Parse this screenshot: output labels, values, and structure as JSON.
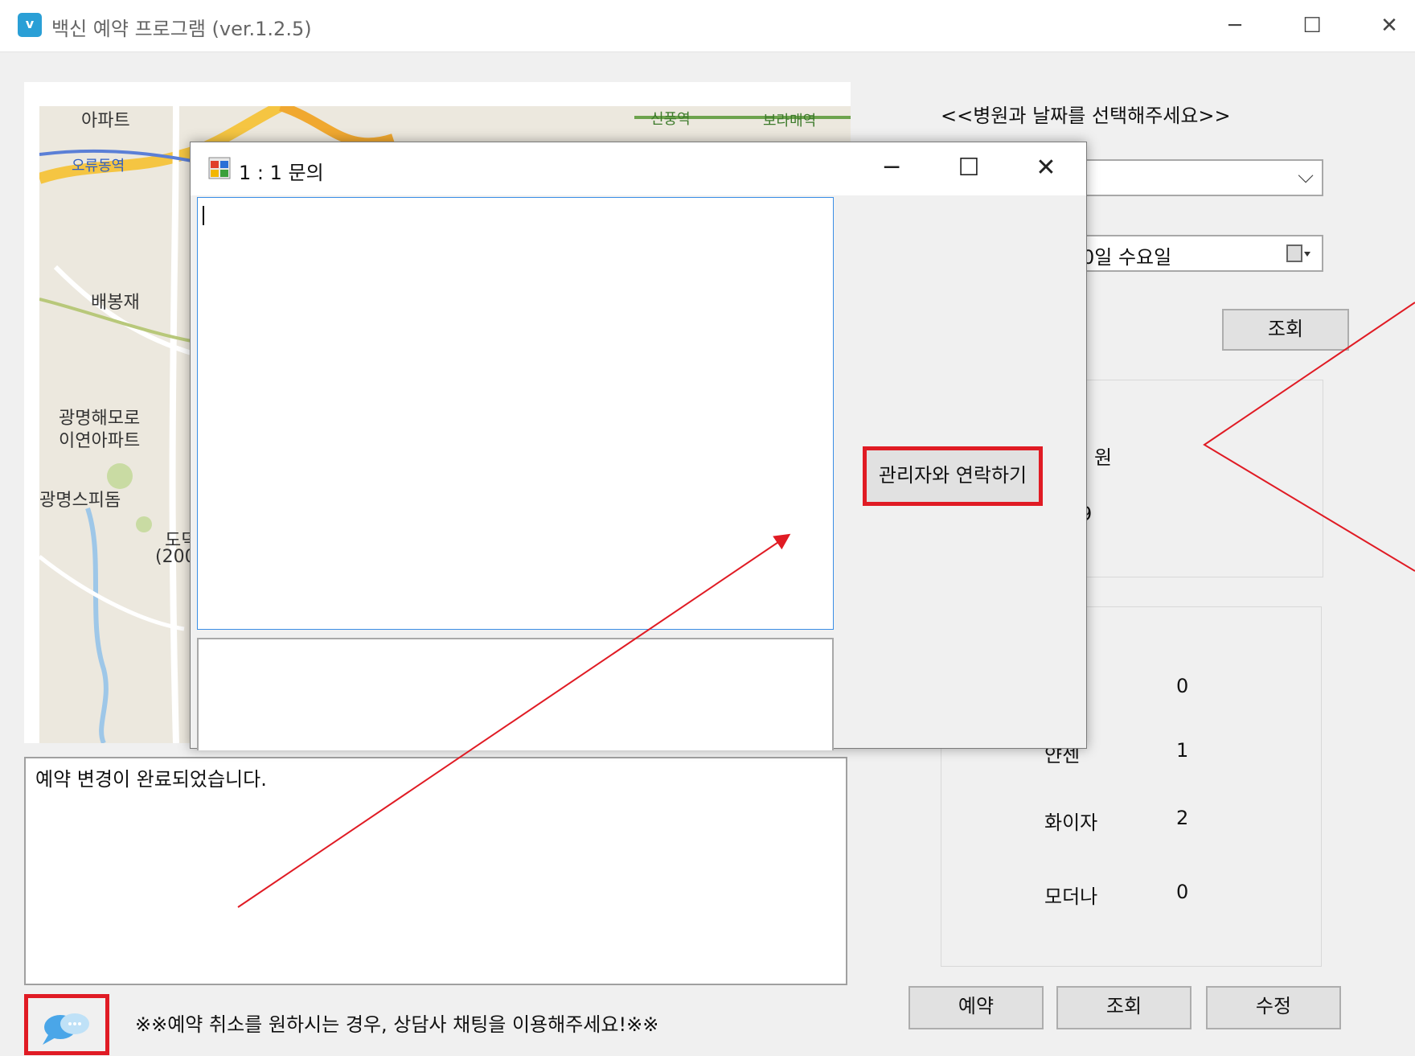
{
  "window": {
    "title": "백신 예약 프로그램 (ver.1.2.5)",
    "icon_letter": "v",
    "controls": [
      "─",
      "☐",
      "✕"
    ]
  },
  "map": {
    "labels": [
      "아파트",
      "오류동역",
      "신풍역",
      "보라매역",
      "배봉재",
      "광명해모로",
      "이연아파트",
      "광명스피돔",
      "도덕",
      "(200"
    ]
  },
  "log": {
    "text": "예약 변경이 완료되었습니다."
  },
  "notice": {
    "text": "※※예약 취소를 원하시는 경우, 상담사 채팅을 이용해주세요!※※"
  },
  "right": {
    "heading": "<<병원과 날짜를 선택해주세요>>",
    "hospital_select": {
      "value": "",
      "arrow": "⌵"
    },
    "date_picker": {
      "value": "0일 수요일"
    },
    "search_button": "조회",
    "info_partial": [
      "원",
      "9"
    ],
    "vaccines": [
      {
        "name": "",
        "count": "0"
      },
      {
        "name": "얀센",
        "count": "1"
      },
      {
        "name": "화이자",
        "count": "2"
      },
      {
        "name": "모더나",
        "count": "0"
      }
    ],
    "bottom_buttons": {
      "reserve": "예약",
      "lookup": "조회",
      "modify": "수정"
    }
  },
  "dialog": {
    "title": "1 : 1 문의",
    "controls": [
      "─",
      "☐",
      "✕"
    ],
    "contact_button": "관리자와 연락하기",
    "input_value": ""
  },
  "colors": {
    "highlight": "#e01b24",
    "window_bg": "#f0f0f0",
    "accent": "#3a8ee6"
  }
}
